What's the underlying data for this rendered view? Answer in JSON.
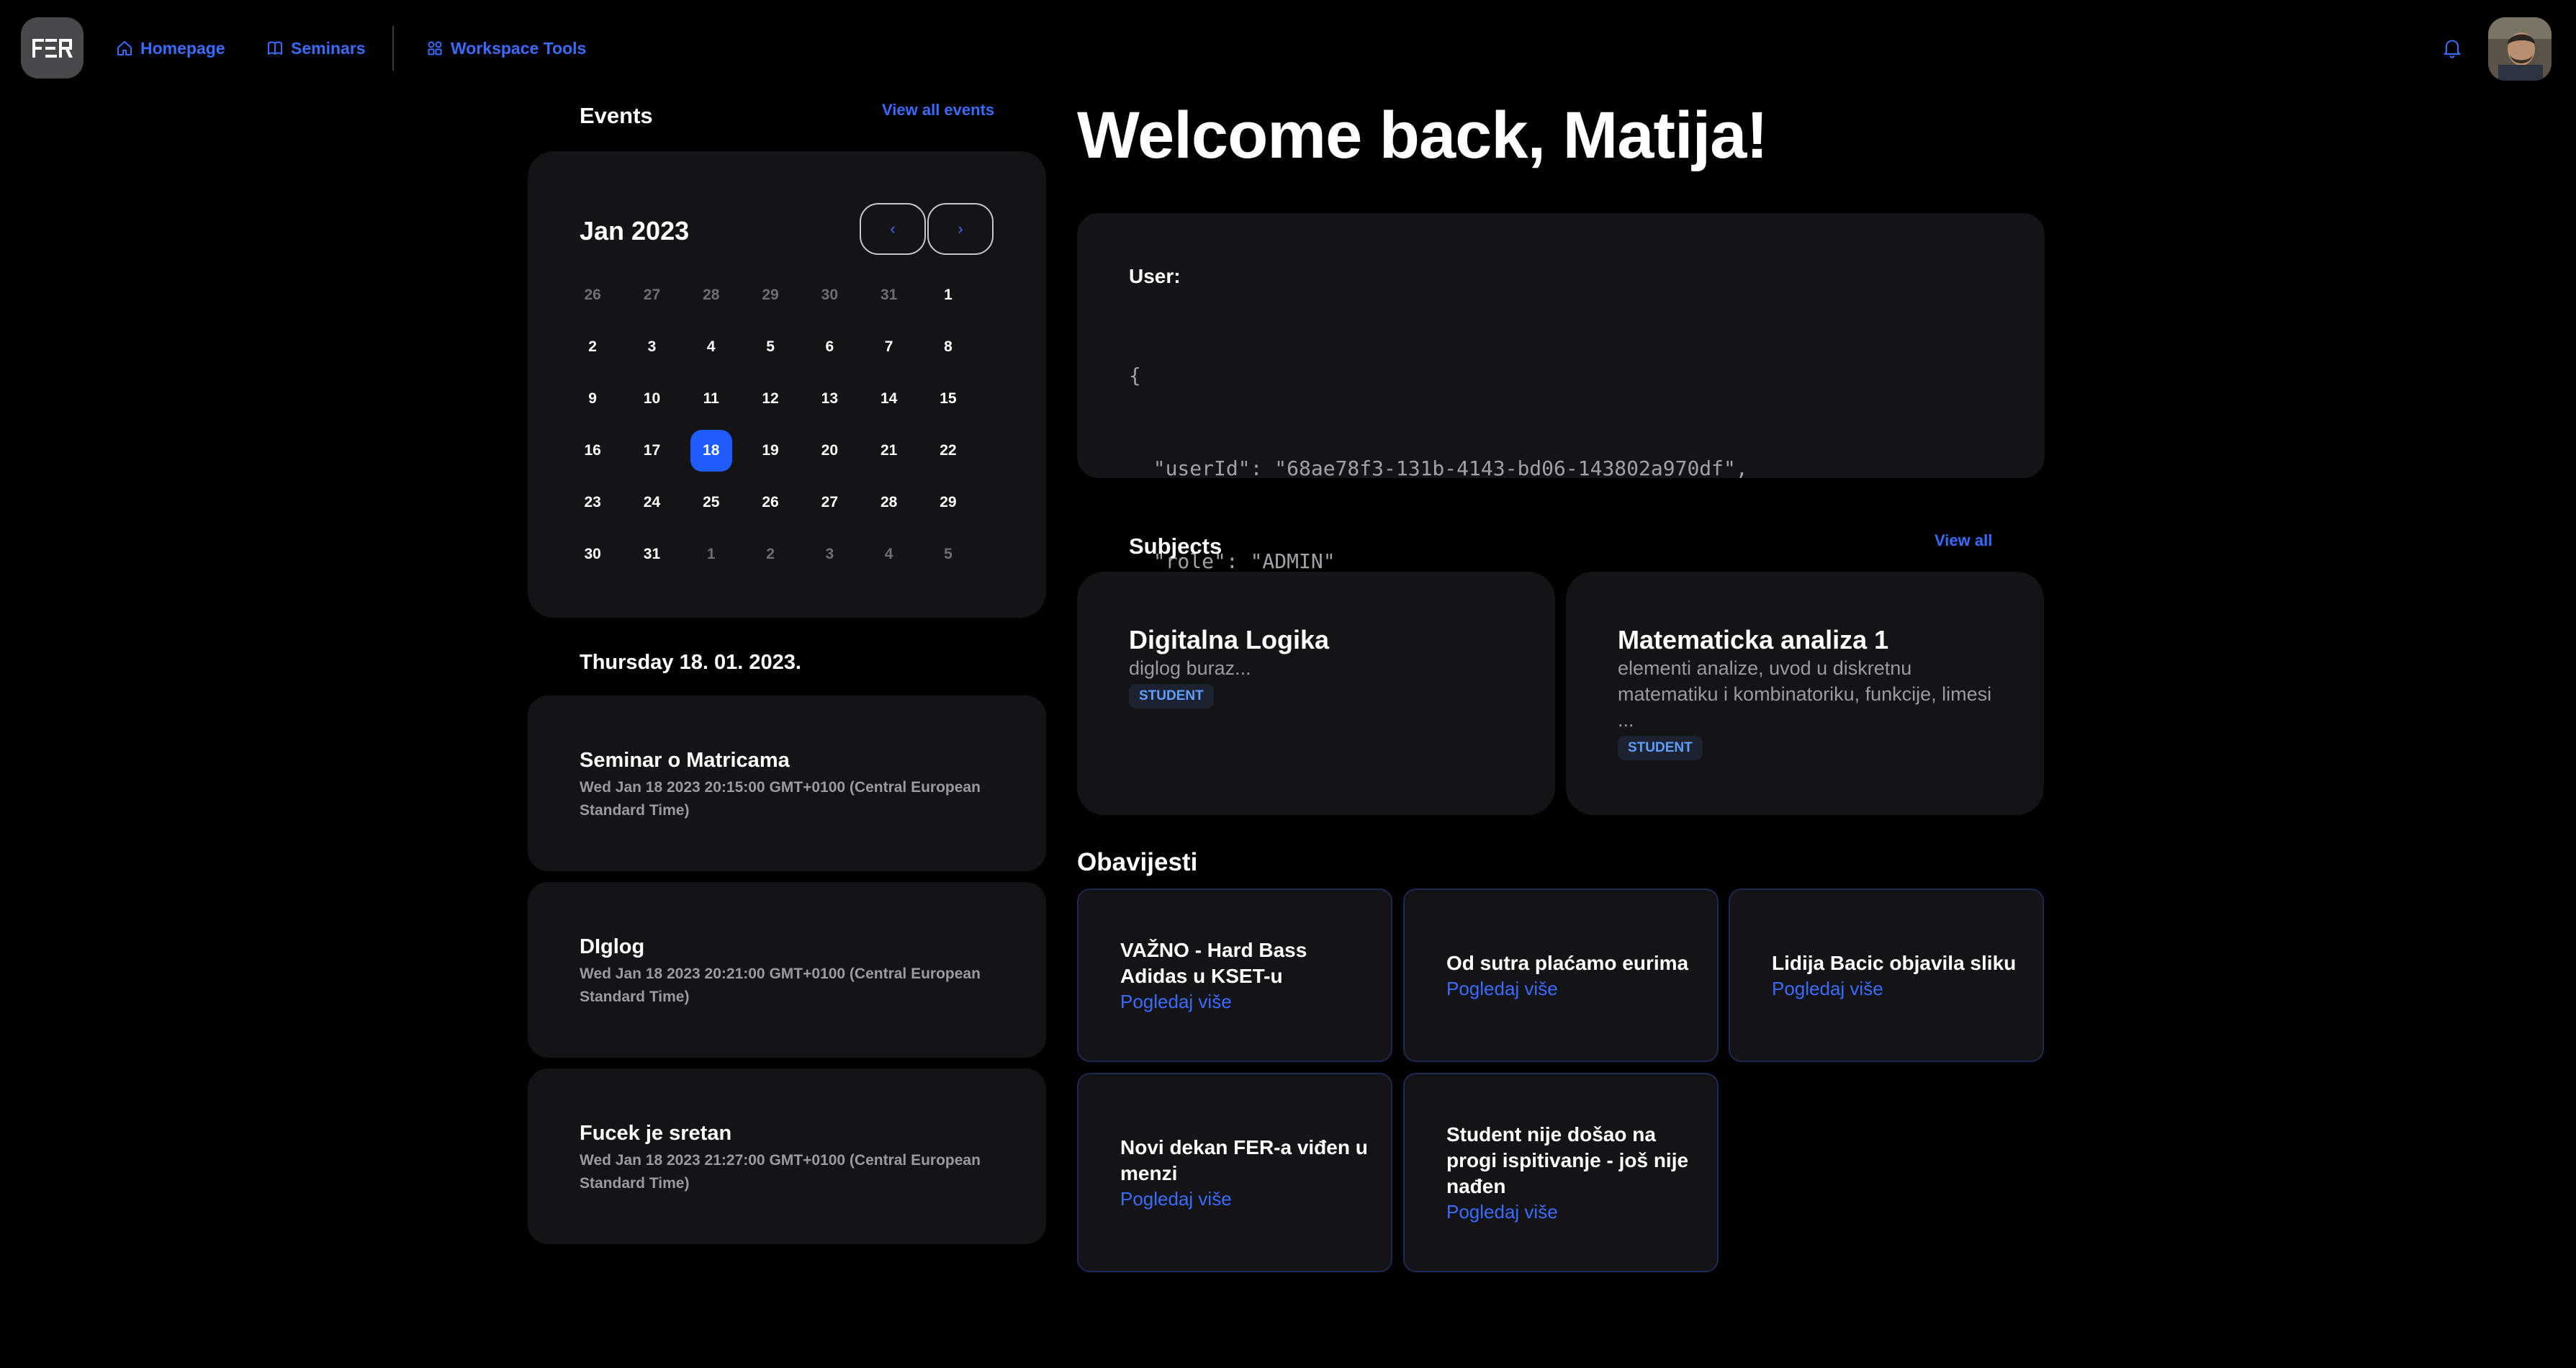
{
  "nav": {
    "logo_text": "FER",
    "homepage": "Homepage",
    "seminars": "Seminars",
    "workspace_tools": "Workspace Tools"
  },
  "events": {
    "title": "Events",
    "view_all": "View all events",
    "calendar": {
      "month_label": "Jan 2023",
      "prev_label": "‹",
      "next_label": "›",
      "selected_day": 18,
      "weeks": [
        [
          {
            "d": "26",
            "m": true
          },
          {
            "d": "27",
            "m": true
          },
          {
            "d": "28",
            "m": true
          },
          {
            "d": "29",
            "m": true
          },
          {
            "d": "30",
            "m": true
          },
          {
            "d": "31",
            "m": true
          },
          {
            "d": "1",
            "m": false
          }
        ],
        [
          {
            "d": "2",
            "m": false
          },
          {
            "d": "3",
            "m": false
          },
          {
            "d": "4",
            "m": false
          },
          {
            "d": "5",
            "m": false
          },
          {
            "d": "6",
            "m": false
          },
          {
            "d": "7",
            "m": false
          },
          {
            "d": "8",
            "m": false
          }
        ],
        [
          {
            "d": "9",
            "m": false
          },
          {
            "d": "10",
            "m": false
          },
          {
            "d": "11",
            "m": false
          },
          {
            "d": "12",
            "m": false
          },
          {
            "d": "13",
            "m": false
          },
          {
            "d": "14",
            "m": false
          },
          {
            "d": "15",
            "m": false
          }
        ],
        [
          {
            "d": "16",
            "m": false
          },
          {
            "d": "17",
            "m": false
          },
          {
            "d": "18",
            "m": false
          },
          {
            "d": "19",
            "m": false
          },
          {
            "d": "20",
            "m": false
          },
          {
            "d": "21",
            "m": false
          },
          {
            "d": "22",
            "m": false
          }
        ],
        [
          {
            "d": "23",
            "m": false
          },
          {
            "d": "24",
            "m": false
          },
          {
            "d": "25",
            "m": false
          },
          {
            "d": "26",
            "m": false
          },
          {
            "d": "27",
            "m": false
          },
          {
            "d": "28",
            "m": false
          },
          {
            "d": "29",
            "m": false
          }
        ],
        [
          {
            "d": "30",
            "m": false
          },
          {
            "d": "31",
            "m": false
          },
          {
            "d": "1",
            "m": true
          },
          {
            "d": "2",
            "m": true
          },
          {
            "d": "3",
            "m": true
          },
          {
            "d": "4",
            "m": true
          },
          {
            "d": "5",
            "m": true
          }
        ]
      ]
    },
    "date_heading": "Thursday 18. 01. 2023.",
    "list": [
      {
        "title": "Seminar o Matricama",
        "time": "Wed Jan 18 2023 20:15:00 GMT+0100 (Central European Standard Time)"
      },
      {
        "title": "DIglog",
        "time": "Wed Jan 18 2023 20:21:00 GMT+0100 (Central European Standard Time)"
      },
      {
        "title": "Fucek je sretan",
        "time": "Wed Jan 18 2023 21:27:00 GMT+0100 (Central European Standard Time)"
      }
    ]
  },
  "welcome": "Welcome back, Matija!",
  "user": {
    "label": "User:",
    "json_lines": [
      "{",
      "  \"userId\": \"68ae78f3-131b-4143-bd06-143802a970df\",",
      "  \"role\": \"ADMIN\"",
      "}"
    ]
  },
  "subjects": {
    "title": "Subjects",
    "view_all": "View all",
    "items": [
      {
        "title": "Digitalna Logika",
        "desc": "diglog buraz...",
        "badge": "STUDENT"
      },
      {
        "title": "Matematicka analiza 1",
        "desc": "elementi analize, uvod u diskretnu matematiku i kombinatoriku, funkcije, limesi ...",
        "badge": "STUDENT"
      }
    ]
  },
  "notices": {
    "title": "Obavijesti",
    "more_label": "Pogledaj više",
    "items": [
      {
        "title": "VAŽNO - Hard Bass Adidas u KSET-u"
      },
      {
        "title": "Od sutra plaćamo eurima"
      },
      {
        "title": "Lidija Bacic objavila sliku"
      },
      {
        "title": "Novi dekan FER-a viđen u menzi"
      },
      {
        "title": "Student nije došao na progi ispitivanje - još nije nađen"
      }
    ]
  },
  "colors": {
    "accent": "#3a6bff",
    "selected": "#1f5cff",
    "card": "#141416",
    "background": "#000000"
  }
}
